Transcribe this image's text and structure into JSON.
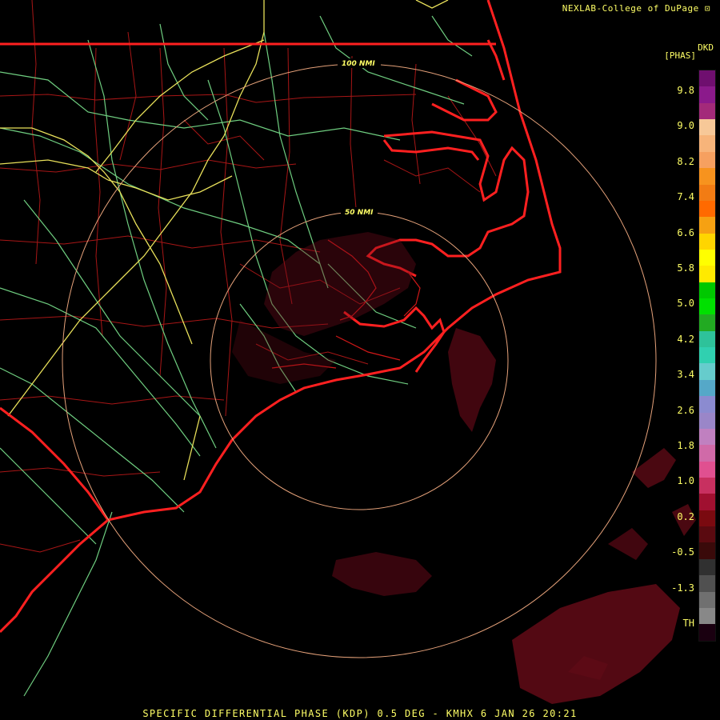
{
  "header": {
    "credit": "NEXLAB-College of DuPage",
    "credit_icon": "logo-mark"
  },
  "legend": {
    "product_code": "DKD",
    "units": "[PHAS]",
    "ticks": [
      "9.8",
      "9.0",
      "8.2",
      "7.4",
      "6.6",
      "5.8",
      "5.0",
      "4.2",
      "3.4",
      "2.6",
      "1.8",
      "1.0",
      "0.2",
      "-0.5",
      "-1.3",
      "TH"
    ],
    "colors": [
      "#6f0f6f",
      "#8b1a8b",
      "#a32a7a",
      "#f7c898",
      "#f7b47a",
      "#f6a060",
      "#f7931e",
      "#f27c14",
      "#ff6a00",
      "#f6a112",
      "#ffd500",
      "#ffff00",
      "#ffea00",
      "#00c800",
      "#00e000",
      "#22aa22",
      "#2ec29a",
      "#30d0b0",
      "#66cccc",
      "#55a8c8",
      "#8b8bd0",
      "#9a86c8",
      "#c080c0",
      "#d06aa8",
      "#e05090",
      "#c83060",
      "#a01030",
      "#7a0a10",
      "#5a0a10",
      "#3a0a0a",
      "#303030",
      "#505050",
      "#707070",
      "#888888",
      "#1a0010"
    ],
    "colorbar_icon": "colorbar-gradient"
  },
  "map": {
    "range_rings": [
      {
        "label": "100 NMI",
        "color": "#e6a27a"
      },
      {
        "label": "50 NMI",
        "color": "#e6a27a"
      }
    ],
    "coastline_color": "#ff2020",
    "county_color": "#b01818",
    "highway_color": "#7fe08f",
    "interstate_color": "#e8e05a",
    "echo_color": "#6e0c1a"
  },
  "footer": {
    "title": "SPECIFIC DIFFERENTIAL PHASE (KDP) 0.5 DEG - KMHX 6 JAN 26 20:21"
  }
}
